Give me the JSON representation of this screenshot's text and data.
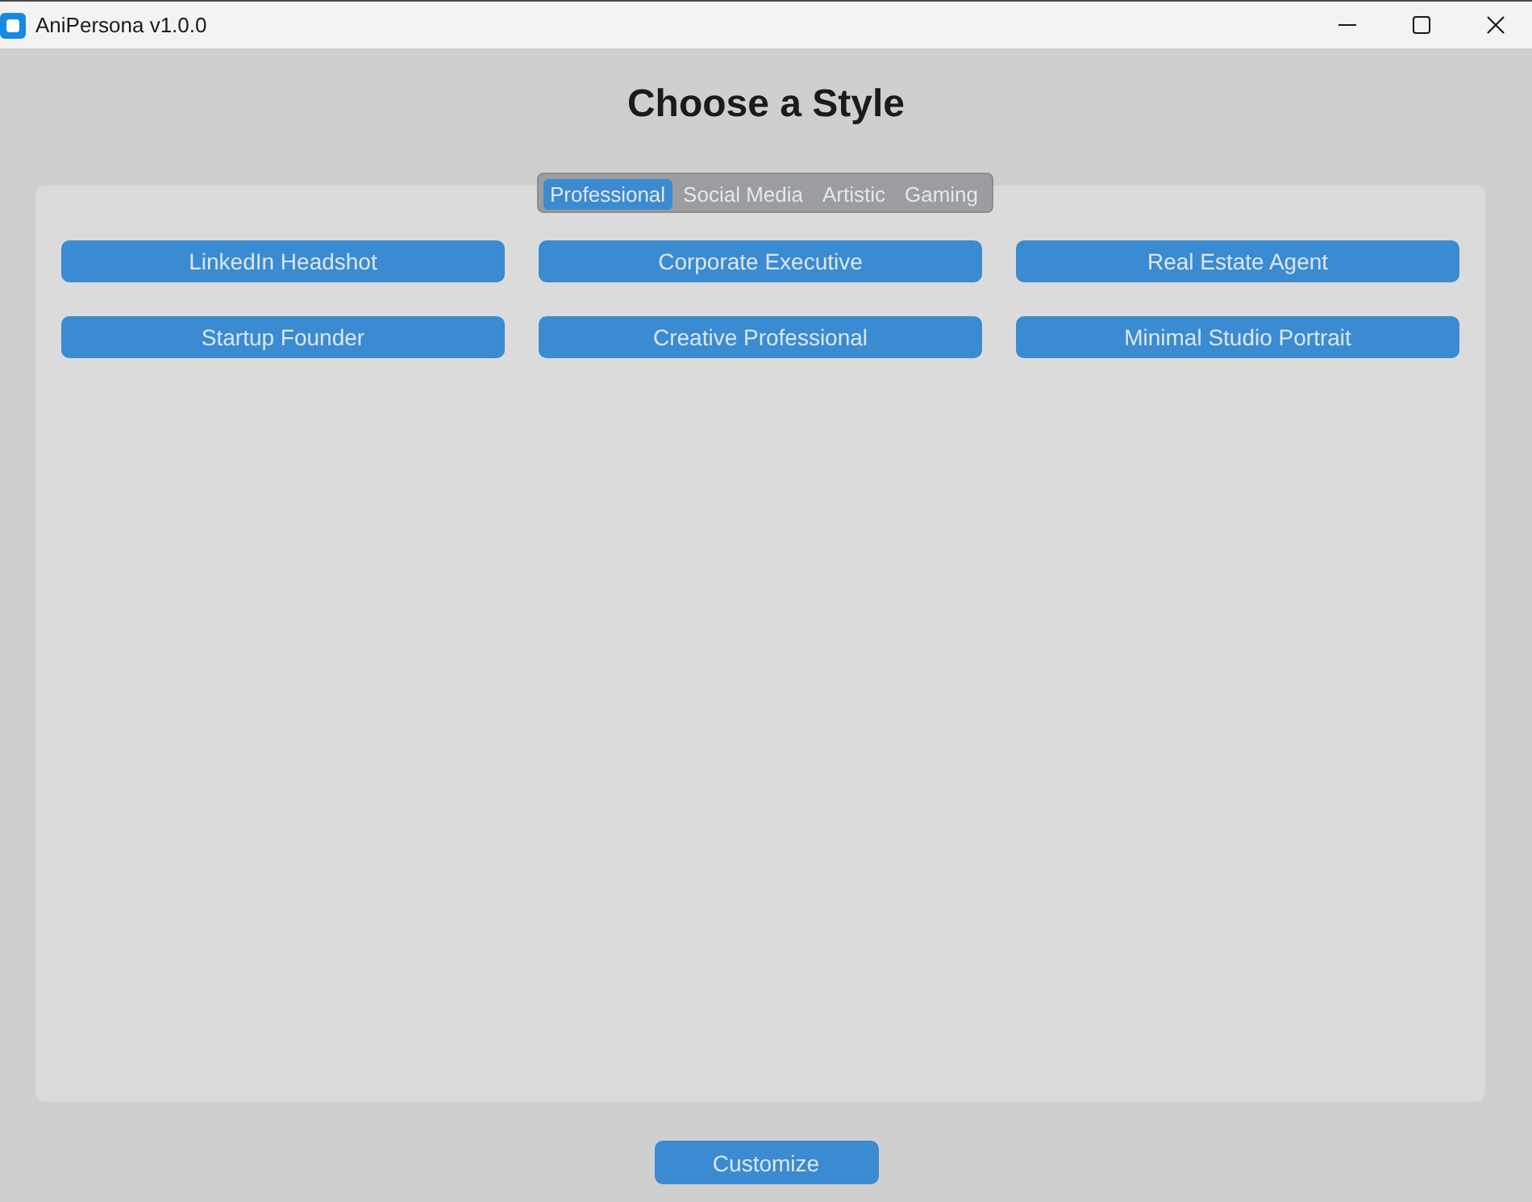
{
  "window": {
    "title": "AniPersona v1.0.0"
  },
  "heading": "Choose a Style",
  "tabs": [
    {
      "label": "Professional",
      "selected": true
    },
    {
      "label": "Social Media",
      "selected": false
    },
    {
      "label": "Artistic",
      "selected": false
    },
    {
      "label": "Gaming",
      "selected": false
    }
  ],
  "style_buttons": [
    "LinkedIn Headshot",
    "Corporate Executive",
    "Real Estate Agent",
    "Startup Founder",
    "Creative Professional",
    "Minimal Studio Portrait"
  ],
  "buttons": [
    "Customize"
  ]
}
